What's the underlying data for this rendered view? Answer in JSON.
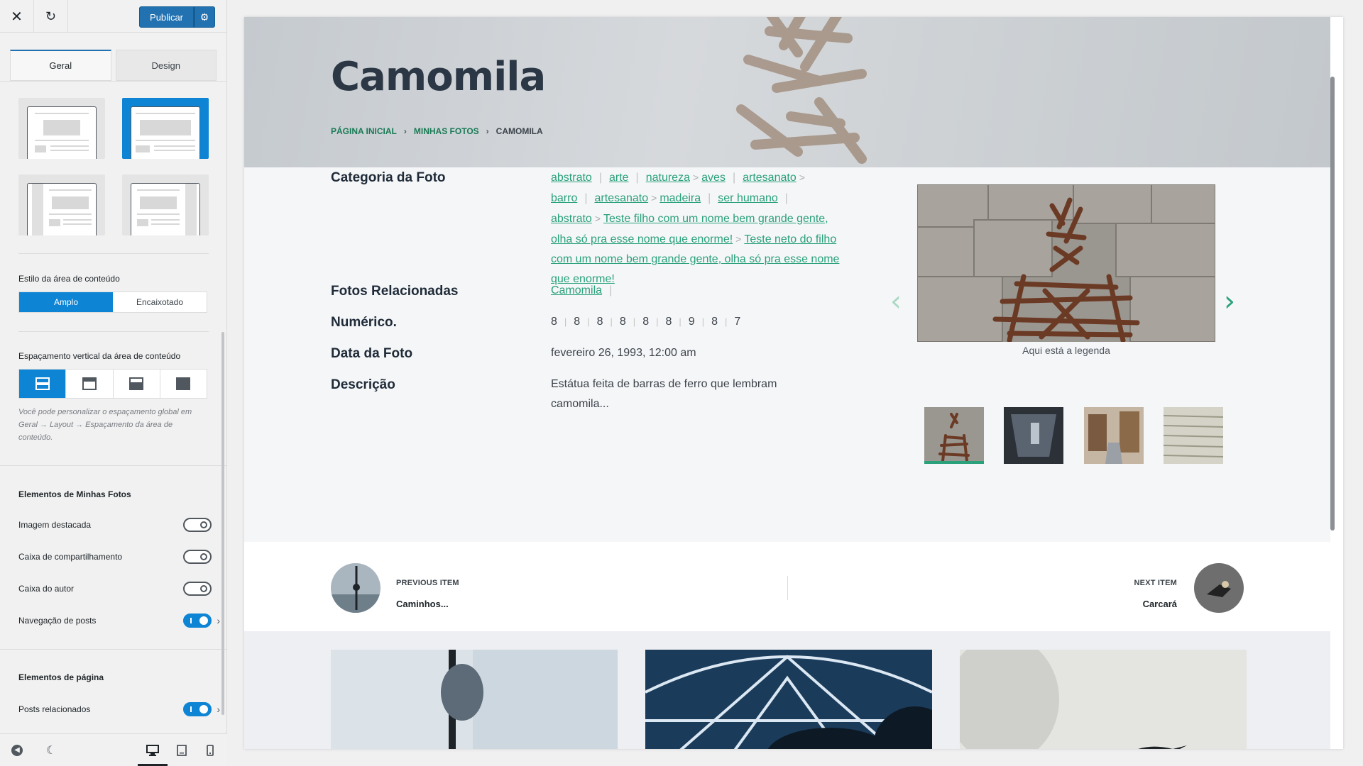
{
  "sidebar": {
    "close_icon": "close-icon",
    "undo_icon": "undo-icon",
    "publish_label": "Publicar",
    "publish_settings_icon": "gear-icon",
    "tabs": [
      {
        "label": "Geral",
        "active": true
      },
      {
        "label": "Design",
        "active": false
      }
    ],
    "content_style": {
      "label": "Estilo da área de conteúdo",
      "options": [
        "Amplo",
        "Encaixotado"
      ],
      "selected": "Amplo"
    },
    "vertical_spacing": {
      "label": "Espaçamento vertical da área de conteúdo",
      "help": "Você pode personalizar o espaçamento global em Geral → Layout → Espaçamento da área de conteúdo."
    },
    "photos_elements": {
      "title": "Elementos de Minhas Fotos",
      "toggles": [
        {
          "label": "Imagem destacada",
          "on": false
        },
        {
          "label": "Caixa de compartilhamento",
          "on": false
        },
        {
          "label": "Caixa do autor",
          "on": false
        },
        {
          "label": "Navegação de posts",
          "on": true
        }
      ]
    },
    "page_elements": {
      "title": "Elementos de página",
      "toggles": [
        {
          "label": "Posts relacionados",
          "on": true
        }
      ]
    },
    "accent_color": "#0e85d4"
  },
  "preview": {
    "title": "Camomila",
    "breadcrumb": [
      "PÁGINA INICIAL",
      "MINHAS FOTOS",
      "CAMOMILA"
    ],
    "fields": {
      "category_label": "Categoria da Foto",
      "related_label": "Fotos Relacionadas",
      "numeric_label": "Numérico.",
      "date_label": "Data da Foto",
      "description_label": "Descrição"
    },
    "categories": {
      "abstrato": "abstrato",
      "arte": "arte",
      "natureza": "natureza",
      "aves": "aves",
      "artesanato": "artesanato",
      "barro": "barro",
      "artesanato2": "artesanato",
      "madeira": "madeira",
      "ser_humano": "ser humano",
      "abstrato2": "abstrato",
      "child": "Teste filho com um nome bem grande gente, olha só pra esse nome que enorme!",
      "grandchild": "Teste neto do filho com um nome bem grande gente, olha só pra esse nome que enorme!"
    },
    "related_photos": [
      "Camomila"
    ],
    "numeric_values": [
      "8",
      "8",
      "8",
      "8",
      "8",
      "8",
      "9",
      "8",
      "7"
    ],
    "date": "fevereiro 26, 1993, 12:00 am",
    "description": "Estátua feita de barras de ferro que lembram camomila...",
    "gallery_caption": "Aqui está a legenda",
    "prev_label": "PREVIOUS ITEM",
    "prev_title": "Caminhos...",
    "next_label": "NEXT ITEM",
    "next_title": "Carcará",
    "link_color": "#2aa17a"
  }
}
